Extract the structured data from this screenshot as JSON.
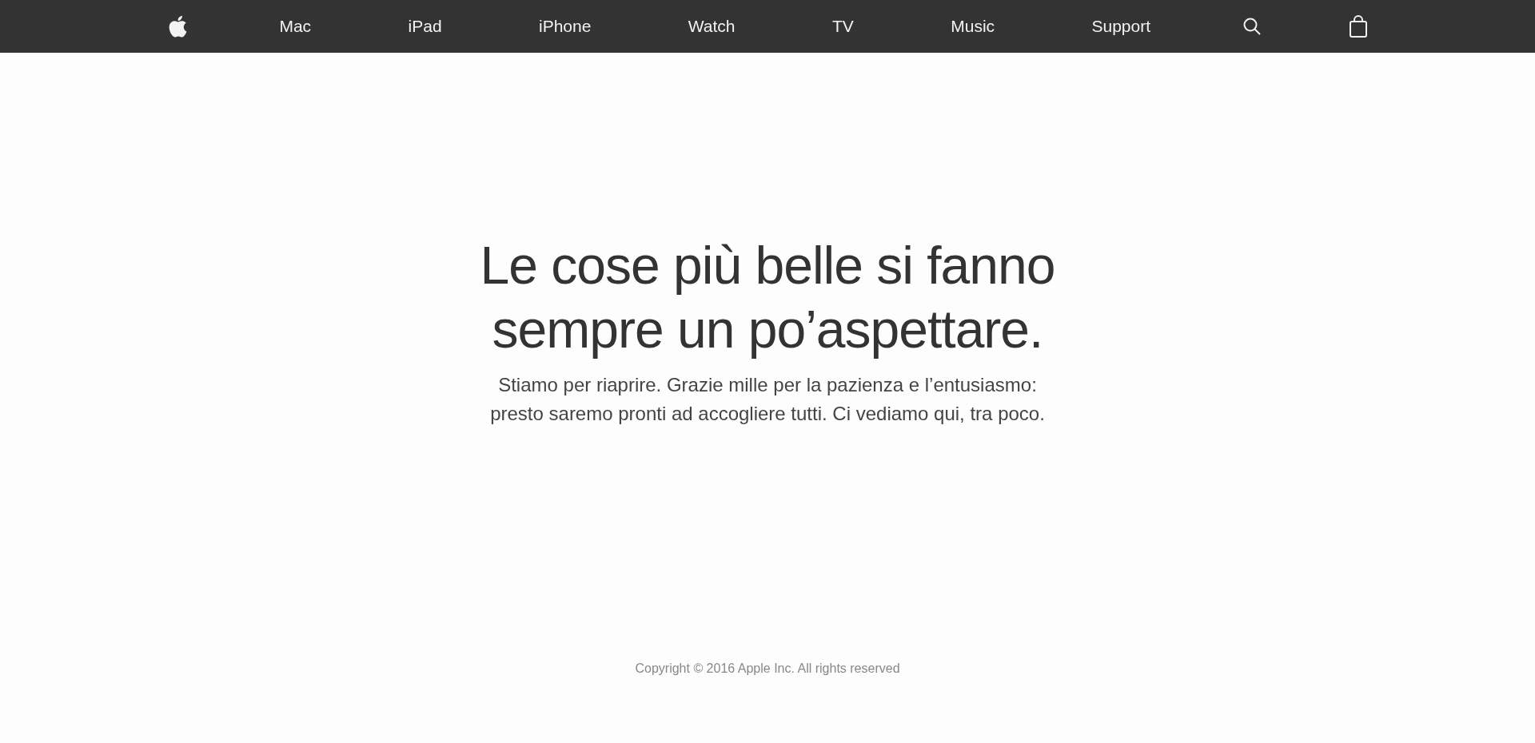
{
  "nav": {
    "items": [
      {
        "kind": "logo"
      },
      {
        "kind": "link",
        "label": "Mac"
      },
      {
        "kind": "link",
        "label": "iPad"
      },
      {
        "kind": "link",
        "label": "iPhone"
      },
      {
        "kind": "link",
        "label": "Watch"
      },
      {
        "kind": "link",
        "label": "TV"
      },
      {
        "kind": "link",
        "label": "Music"
      },
      {
        "kind": "link",
        "label": "Support"
      },
      {
        "kind": "search"
      },
      {
        "kind": "bag"
      }
    ]
  },
  "hero": {
    "headline_lines": [
      "Le cose più belle si fanno",
      "sempre un po’aspettare."
    ],
    "subtitle_lines": [
      "Stiamo per riaprire. Grazie mille per la pazienza e l’entusiasmo:",
      "presto saremo pronti ad accogliere tutti. Ci vediamo qui, tra poco."
    ]
  },
  "footer": {
    "copyright": "Copyright © 2016 Apple Inc. All rights reserved"
  }
}
